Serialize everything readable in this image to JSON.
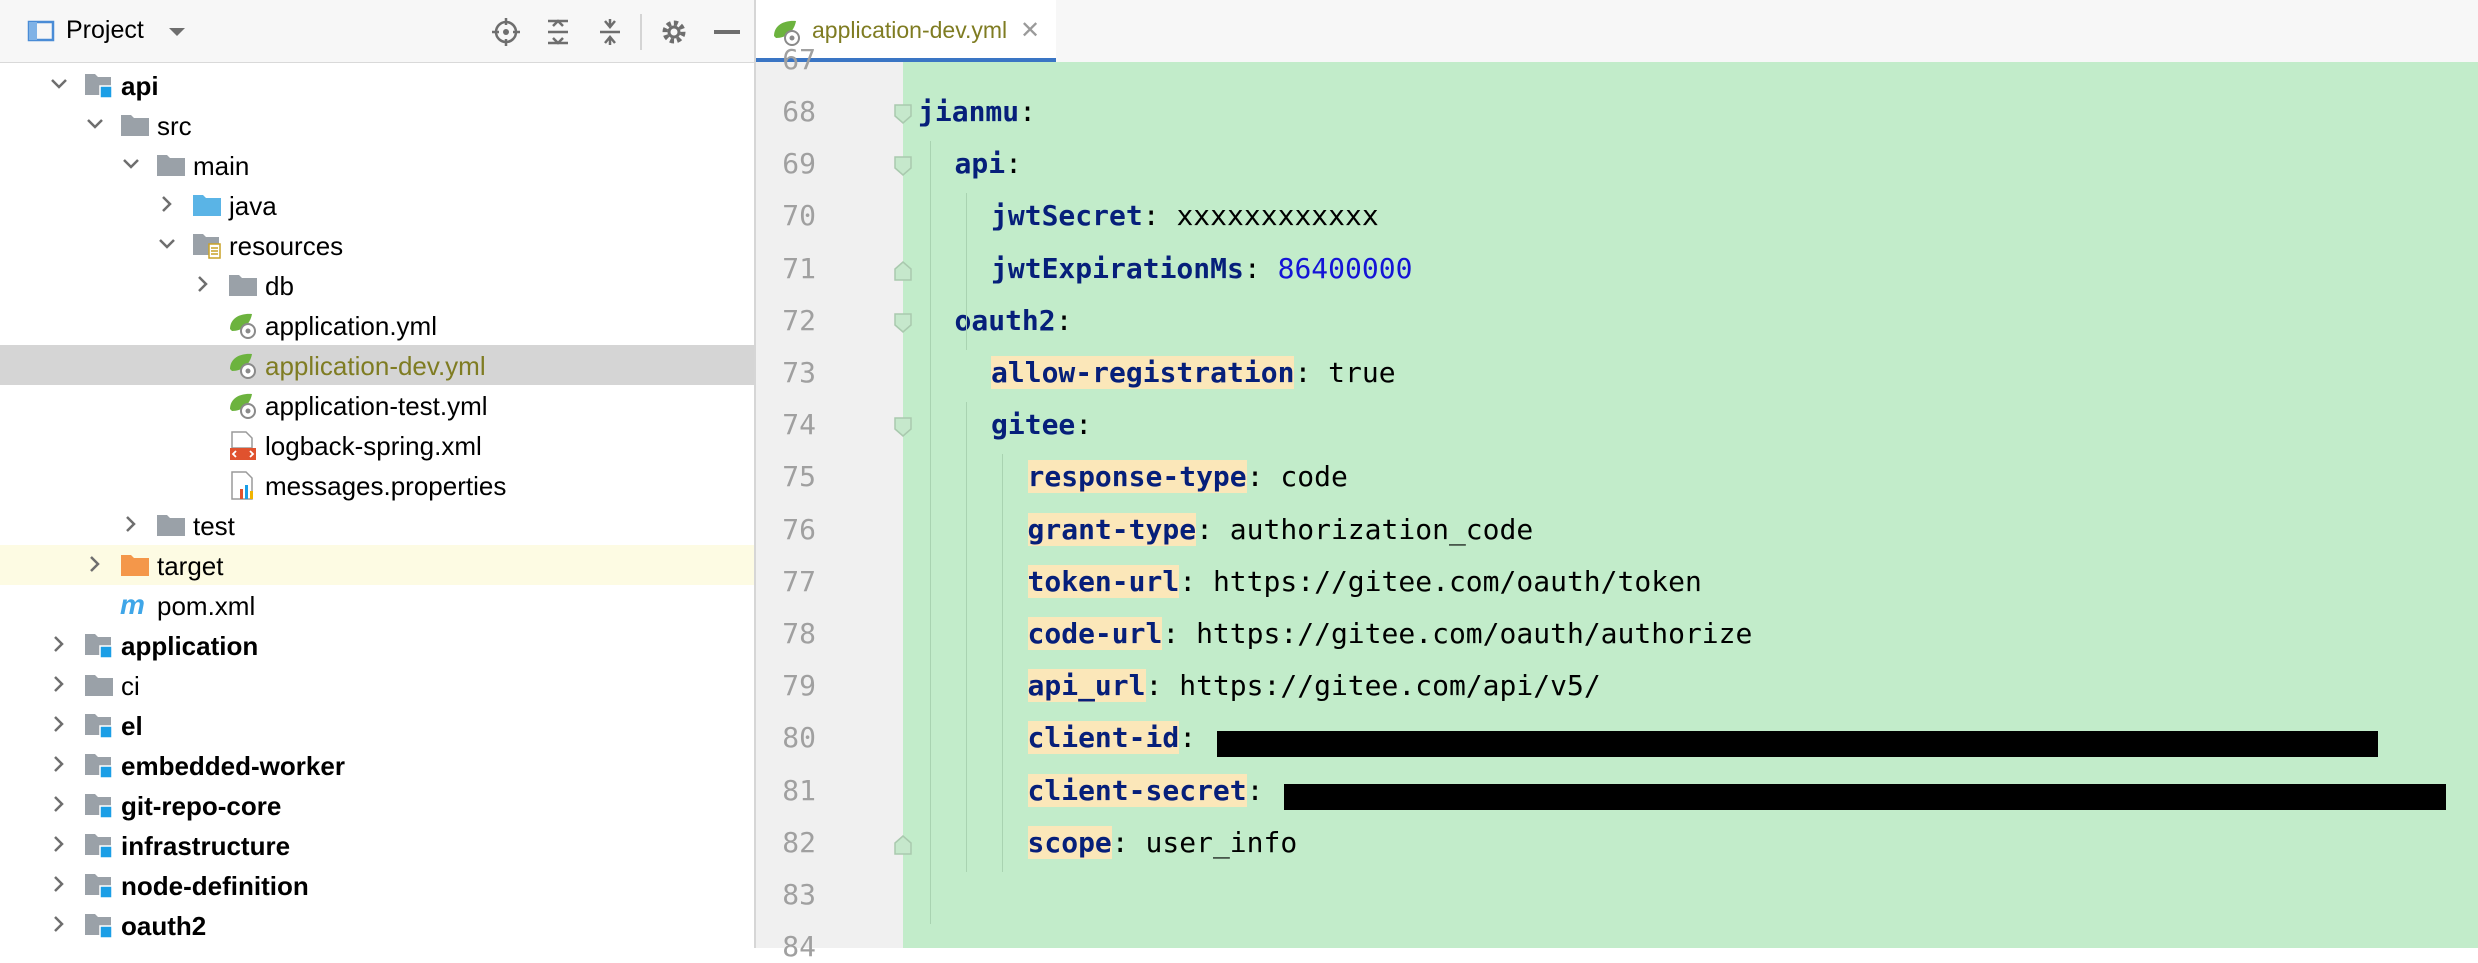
{
  "project_panel": {
    "title": "Project",
    "toolbar_icons": [
      "locate-icon",
      "expand-all-icon",
      "collapse-all-icon",
      "gear-icon",
      "hide-icon"
    ]
  },
  "tree": [
    {
      "label": "api",
      "depth": 0,
      "expanded": true,
      "icon": "module-folder-icon",
      "bold": true
    },
    {
      "label": "src",
      "depth": 1,
      "expanded": true,
      "icon": "folder-icon"
    },
    {
      "label": "main",
      "depth": 2,
      "expanded": true,
      "icon": "folder-icon"
    },
    {
      "label": "java",
      "depth": 3,
      "expanded": false,
      "icon": "source-folder-icon"
    },
    {
      "label": "resources",
      "depth": 3,
      "expanded": true,
      "icon": "resources-folder-icon"
    },
    {
      "label": "db",
      "depth": 4,
      "expanded": false,
      "icon": "folder-icon"
    },
    {
      "label": "application.yml",
      "depth": 4,
      "icon": "spring-yaml-icon"
    },
    {
      "label": "application-dev.yml",
      "depth": 4,
      "icon": "spring-yaml-icon",
      "selected": true
    },
    {
      "label": "application-test.yml",
      "depth": 4,
      "icon": "spring-yaml-icon"
    },
    {
      "label": "logback-spring.xml",
      "depth": 4,
      "icon": "xml-file-icon"
    },
    {
      "label": "messages.properties",
      "depth": 4,
      "icon": "properties-file-icon"
    },
    {
      "label": "test",
      "depth": 2,
      "expanded": false,
      "icon": "folder-icon"
    },
    {
      "label": "target",
      "depth": 1,
      "expanded": false,
      "icon": "excluded-folder-icon",
      "highlighted": true
    },
    {
      "label": "pom.xml",
      "depth": 1,
      "icon": "maven-icon"
    },
    {
      "label": "application",
      "depth": 0,
      "expanded": false,
      "icon": "module-folder-icon",
      "bold": true
    },
    {
      "label": "ci",
      "depth": 0,
      "expanded": false,
      "icon": "folder-icon"
    },
    {
      "label": "el",
      "depth": 0,
      "expanded": false,
      "icon": "module-folder-icon",
      "bold": true
    },
    {
      "label": "embedded-worker",
      "depth": 0,
      "expanded": false,
      "icon": "module-folder-icon",
      "bold": true
    },
    {
      "label": "git-repo-core",
      "depth": 0,
      "expanded": false,
      "icon": "module-folder-icon",
      "bold": true
    },
    {
      "label": "infrastructure",
      "depth": 0,
      "expanded": false,
      "icon": "module-folder-icon",
      "bold": true
    },
    {
      "label": "node-definition",
      "depth": 0,
      "expanded": false,
      "icon": "module-folder-icon",
      "bold": true
    },
    {
      "label": "oauth2",
      "depth": 0,
      "expanded": false,
      "icon": "module-folder-icon",
      "bold": true
    }
  ],
  "editor": {
    "tab_label": "application-dev.yml",
    "top_partial_line": "67",
    "bottom_partial_line": "84",
    "lines": [
      {
        "num": "68",
        "indent": 0,
        "key": "jianmu",
        "sep": ":",
        "value": "",
        "vtype": "",
        "fold": "start"
      },
      {
        "num": "69",
        "indent": 1,
        "key": "api",
        "sep": ":",
        "value": "",
        "vtype": "",
        "fold": "start"
      },
      {
        "num": "70",
        "indent": 2,
        "key": "jwtSecret",
        "sep": ": ",
        "value": "xxxxxxxxxxxx",
        "vtype": "v"
      },
      {
        "num": "71",
        "indent": 2,
        "key": "jwtExpirationMs",
        "sep": ": ",
        "value": "86400000",
        "vtype": "n",
        "fold": "end"
      },
      {
        "num": "72",
        "indent": 1,
        "key": "oauth2",
        "sep": ":",
        "value": "",
        "vtype": "",
        "fold": "start"
      },
      {
        "num": "73",
        "indent": 2,
        "key": "allow-registration",
        "sep": ": ",
        "value": "true",
        "vtype": "v",
        "keybg": true
      },
      {
        "num": "74",
        "indent": 2,
        "key": "gitee",
        "sep": ":",
        "value": "",
        "vtype": "",
        "fold": "start"
      },
      {
        "num": "75",
        "indent": 3,
        "key": "response-type",
        "sep": ": ",
        "value": "code",
        "vtype": "v",
        "keybg": true
      },
      {
        "num": "76",
        "indent": 3,
        "key": "grant-type",
        "sep": ": ",
        "value": "authorization_code",
        "vtype": "v",
        "keybg": true
      },
      {
        "num": "77",
        "indent": 3,
        "key": "token-url",
        "sep": ": ",
        "value": "https://gitee.com/oauth/token",
        "vtype": "v",
        "keybg": true
      },
      {
        "num": "78",
        "indent": 3,
        "key": "code-url",
        "sep": ": ",
        "value": "https://gitee.com/oauth/authorize",
        "vtype": "v",
        "keybg": true
      },
      {
        "num": "79",
        "indent": 3,
        "key": "api_url",
        "sep": ": ",
        "value": "https://gitee.com/api/v5/",
        "vtype": "v",
        "keybg": true
      },
      {
        "num": "80",
        "indent": 3,
        "key": "client-id",
        "sep": ": ",
        "value": "",
        "vtype": "redacted",
        "keybg": true
      },
      {
        "num": "81",
        "indent": 3,
        "key": "client-secret",
        "sep": ": ",
        "value": "",
        "vtype": "redacted",
        "keybg": true
      },
      {
        "num": "82",
        "indent": 3,
        "key": "scope",
        "sep": ": ",
        "value": "user_info",
        "vtype": "v",
        "keybg": true,
        "fold": "end"
      },
      {
        "num": "83",
        "indent": 0,
        "key": "",
        "sep": "",
        "value": "",
        "vtype": ""
      }
    ]
  }
}
